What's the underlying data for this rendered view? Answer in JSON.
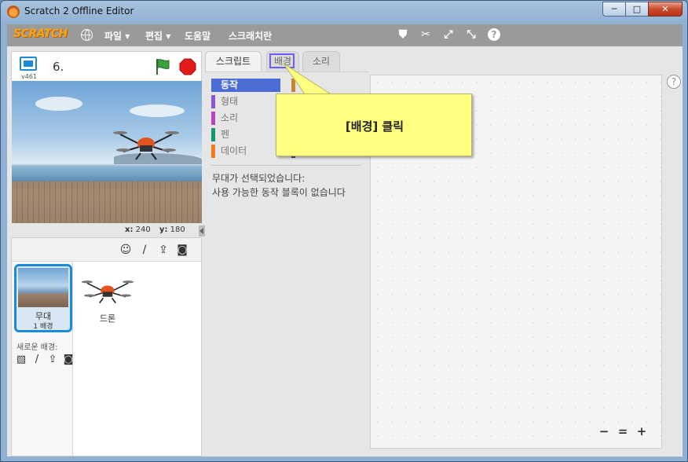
{
  "window": {
    "title": "Scratch 2 Offline Editor",
    "minimize": "─",
    "maximize": "□",
    "close": "✕"
  },
  "menu": {
    "logo": "SCRATCH",
    "items": [
      "파일 ▾",
      "편집 ▾",
      "도움말",
      "스크래치란"
    ],
    "tools": [
      "stamp-icon",
      "delete-tool-icon",
      "grow-icon",
      "shrink-icon",
      "help-icon"
    ],
    "tool_glyphs": [
      "⛊",
      "✂",
      "⤢",
      "⤡",
      "?"
    ]
  },
  "stage": {
    "version": "v461",
    "project_name": "6.",
    "x_label": "x:",
    "x_value": "240",
    "y_label": "y:",
    "y_value": "180"
  },
  "sprites": {
    "stage_name": "무대",
    "stage_backdrops": "1 배경",
    "new_backdrop_label": "새로운 배경:",
    "sprite_name": "드론"
  },
  "tabs": [
    "스크립트",
    "배경",
    "소리"
  ],
  "palette": {
    "categories": [
      {
        "label": "동작",
        "color": "#4a6cd4"
      },
      {
        "label": "형태",
        "color": "#8a55d7"
      },
      {
        "label": "소리",
        "color": "#bb42c3"
      },
      {
        "label": "펜",
        "color": "#0e9a6c"
      },
      {
        "label": "데이터",
        "color": "#ee7d16"
      }
    ],
    "message_line1": "무대가 선택되었습니다:",
    "message_line2": "사용 가능한 동작 블록이 없습니다"
  },
  "script_area": {
    "help": "?",
    "zoom_out": "−",
    "zoom_reset": "=",
    "zoom_in": "+"
  },
  "callout": {
    "text": "[배경] 클릭"
  }
}
